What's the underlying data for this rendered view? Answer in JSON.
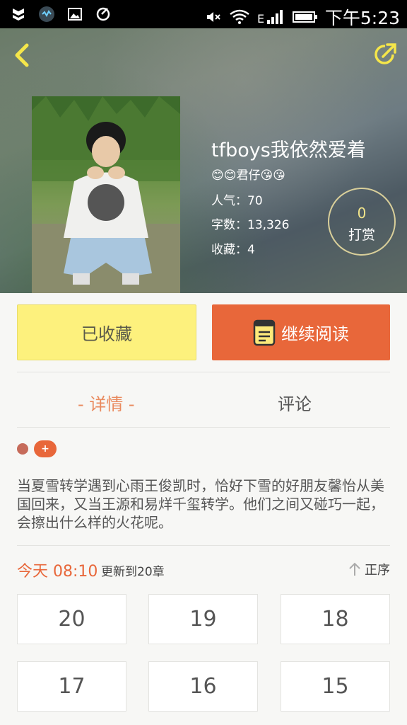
{
  "status_bar": {
    "time": "下午5:23",
    "icons": [
      "shield-icon",
      "app-icon",
      "image-icon",
      "sync-icon",
      "mute-icon",
      "wifi-icon",
      "signal-icon",
      "battery-icon"
    ]
  },
  "book": {
    "title": "tfboys我依然爱着",
    "author": "😊😊君仔😘😘",
    "popularity_label": "人气：",
    "popularity": "70",
    "words_label": "字数：",
    "words": "13,326",
    "favorites_label": "收藏：",
    "favorites": "4"
  },
  "tip": {
    "count": "0",
    "label": "打赏"
  },
  "actions": {
    "collected": "已收藏",
    "continue_reading": "继续阅读"
  },
  "tabs": {
    "details": "- 详情 -",
    "comments": "评论"
  },
  "tags": {
    "add": "+"
  },
  "description": "当夏雪转学遇到心雨王俊凯时，恰好下雪的好朋友馨怡从美国回来，又当王源和易烊千玺转学。他们之间又碰巧一起，会擦出什么样的火花呢。",
  "update": {
    "time": "今天 08:10",
    "text": "更新到20章",
    "sort_label": "正序"
  },
  "chapters": [
    "20",
    "19",
    "18",
    "17",
    "16",
    "15"
  ],
  "colors": {
    "accent": "#e8673a",
    "collected_bg": "#fdf17d",
    "tab_active": "#e98a5e"
  }
}
